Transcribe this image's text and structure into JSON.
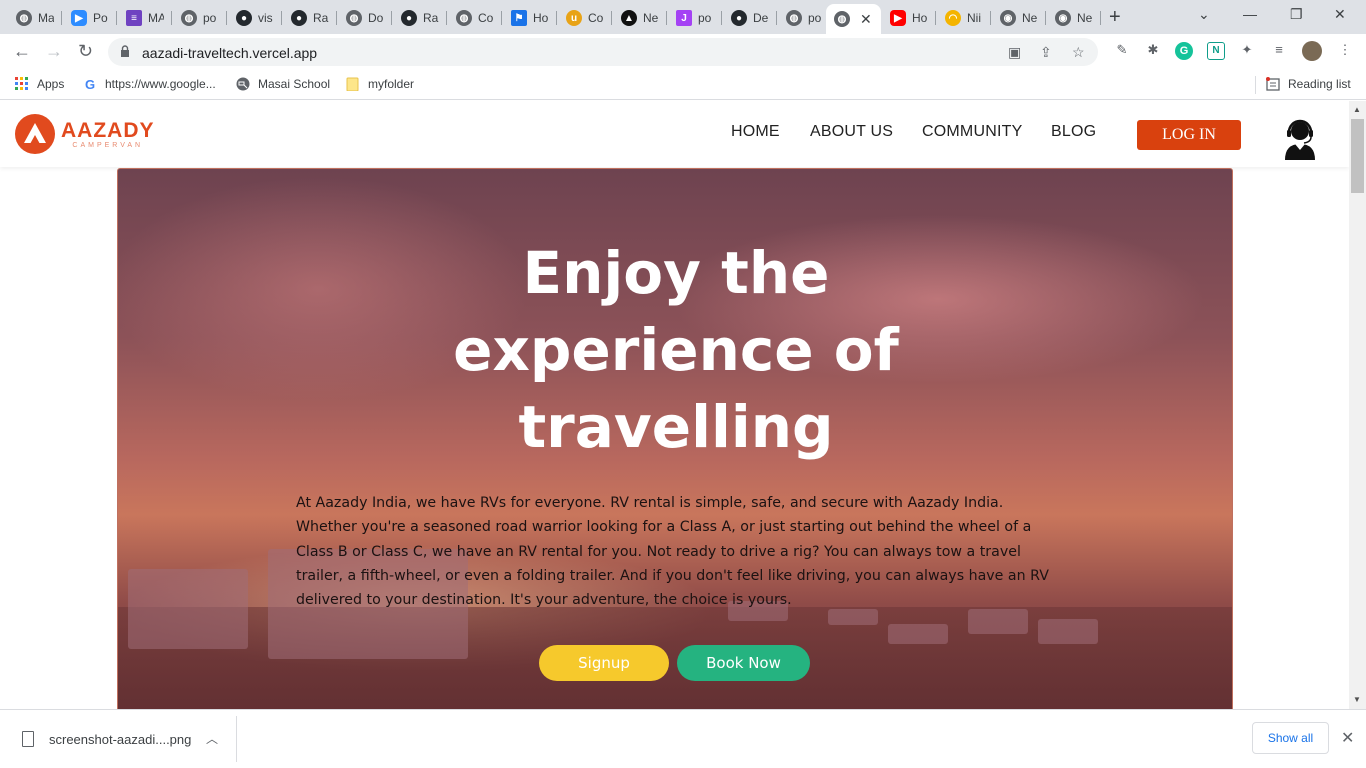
{
  "browser": {
    "tabs": [
      {
        "title": "Ma",
        "icon": "globe-icon",
        "color": "#5f6368"
      },
      {
        "title": "Po",
        "icon": "zoom-icon",
        "color": "#2d8cff"
      },
      {
        "title": "MA",
        "icon": "list-icon",
        "color": "#6f42c1"
      },
      {
        "title": "po",
        "icon": "globe-icon",
        "color": "#5f6368"
      },
      {
        "title": "vis",
        "icon": "github-icon",
        "color": "#24292e"
      },
      {
        "title": "Ra",
        "icon": "github-icon",
        "color": "#24292e"
      },
      {
        "title": "Do",
        "icon": "globe-icon",
        "color": "#5f6368"
      },
      {
        "title": "Ra",
        "icon": "github-icon",
        "color": "#24292e"
      },
      {
        "title": "Co",
        "icon": "globe-icon",
        "color": "#5f6368"
      },
      {
        "title": "Ho",
        "icon": "flag-icon",
        "color": "#1a73e8"
      },
      {
        "title": "Co",
        "icon": "cup-icon",
        "color": "#e8a317"
      },
      {
        "title": "Ne",
        "icon": "triangle-icon",
        "color": "#111111"
      },
      {
        "title": "po",
        "icon": "j-icon",
        "color": "#a442f4"
      },
      {
        "title": "De",
        "icon": "github-icon",
        "color": "#24292e"
      },
      {
        "title": "po",
        "icon": "globe-icon",
        "color": "#5f6368"
      },
      {
        "title": "",
        "icon": "globe-icon",
        "color": "#5f6368",
        "active": true
      },
      {
        "title": "Ho",
        "icon": "youtube-icon",
        "color": "#ff0000"
      },
      {
        "title": "Nii",
        "icon": "rainbow-icon",
        "color": "#f4b400"
      },
      {
        "title": "Ne",
        "icon": "chrome-icon",
        "color": "#5f6368"
      },
      {
        "title": "Ne",
        "icon": "chrome-icon",
        "color": "#5f6368"
      }
    ],
    "url": "aazadi-traveltech.vercel.app",
    "bookmarks": [
      {
        "label": "Apps",
        "icon": "apps-grid-icon"
      },
      {
        "label": "https://www.google...",
        "icon": "google-icon"
      },
      {
        "label": "Masai School",
        "icon": "globe-icon"
      },
      {
        "label": "myfolder",
        "icon": "folder-icon"
      }
    ],
    "reading_list": "Reading list",
    "download": {
      "filename": "screenshot-aazadi....png",
      "show_all": "Show all"
    }
  },
  "site": {
    "logo": {
      "brand": "AAZADY",
      "sub": "CAMPERVAN"
    },
    "nav": [
      "HOME",
      "ABOUT US",
      "COMMUNITY",
      "BLOG"
    ],
    "login": "LOG IN",
    "hero": {
      "title": "Enjoy the experience of travelling",
      "body": "At Aazady India, we have RVs for everyone. RV rental is simple, safe, and secure with Aazady India. Whether you're a seasoned road warrior looking for a Class A, or just starting out behind the wheel of a Class B or Class C, we have an RV rental for you. Not ready to drive a rig? You can always tow a travel trailer, a fifth-wheel, or even a folding trailer. And if you don't feel like driving, you can always have an RV delivered to your destination. It's your adventure, the choice is yours.",
      "signup": "Signup",
      "book": "Book Now"
    },
    "colors": {
      "brand": "#e14a1e",
      "login": "#d9410e",
      "signup": "#f6c92c",
      "book": "#25b380"
    }
  }
}
